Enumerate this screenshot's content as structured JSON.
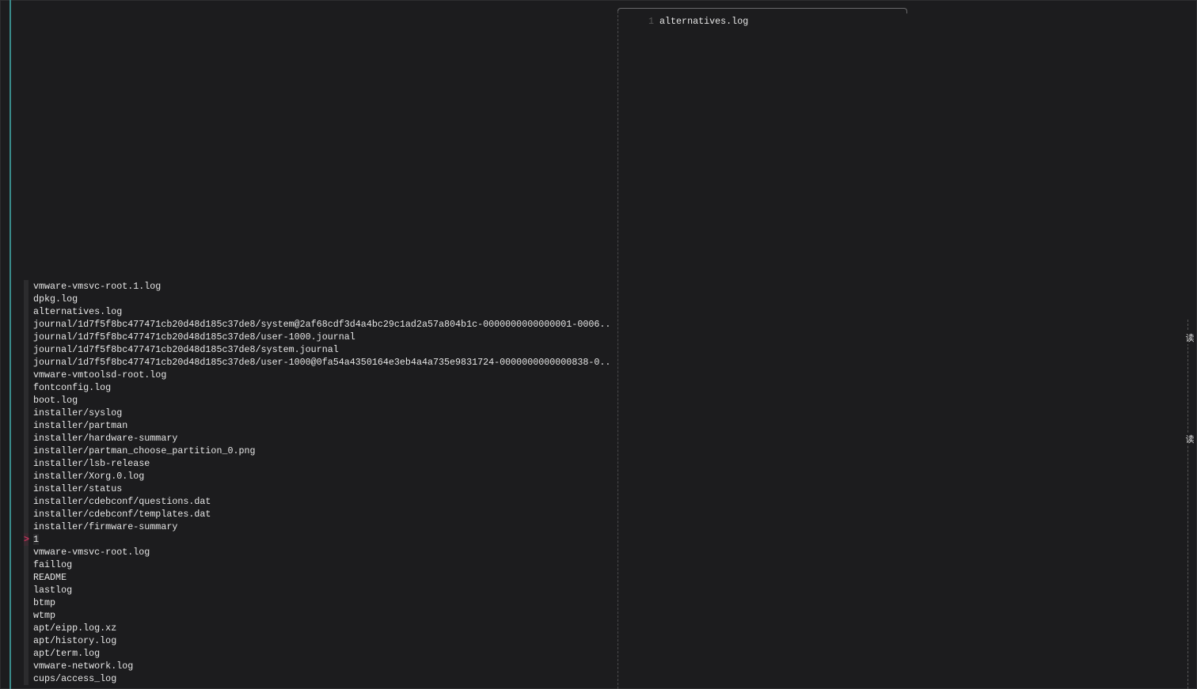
{
  "results": [
    "vmware-vmsvc-root.1.log",
    "dpkg.log",
    "alternatives.log",
    "journal/1d7f5f8bc477471cb20d48d185c37de8/system@2af68cdf3d4a4bc29c1ad2a57a804b1c-0000000000000001-0006..",
    "journal/1d7f5f8bc477471cb20d48d185c37de8/user-1000.journal",
    "journal/1d7f5f8bc477471cb20d48d185c37de8/system.journal",
    "journal/1d7f5f8bc477471cb20d48d185c37de8/user-1000@0fa54a4350164e3eb4a4a735e9831724-0000000000000838-0..",
    "vmware-vmtoolsd-root.log",
    "fontconfig.log",
    "boot.log",
    "installer/syslog",
    "installer/partman",
    "installer/hardware-summary",
    "installer/partman_choose_partition_0.png",
    "installer/lsb-release",
    "installer/Xorg.0.log",
    "installer/status",
    "installer/cdebconf/questions.dat",
    "installer/cdebconf/templates.dat",
    "installer/firmware-summary",
    "1",
    "vmware-vmsvc-root.log",
    "faillog",
    "README",
    "lastlog",
    "btmp",
    "wtmp",
    "apt/eipp.log.xz",
    "apt/history.log",
    "apt/term.log",
    "vmware-network.log",
    "cups/access_log"
  ],
  "current_index": 20,
  "pointer": ">",
  "preview": {
    "line_number": "1",
    "content": "alternatives.log"
  },
  "scroll_marks": [
    "读",
    "读"
  ],
  "colors": {
    "accent": "#3a8a8a",
    "pointer": "#c0325a",
    "background": "#1c1c1e"
  }
}
